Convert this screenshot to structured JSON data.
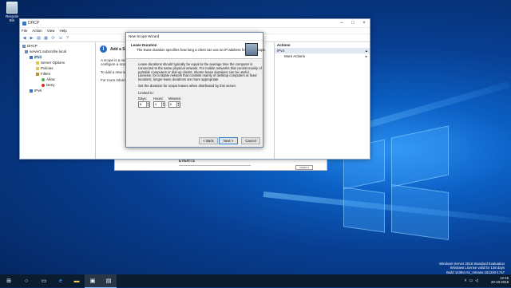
{
  "desktop": {
    "recycle_bin_label": "Recycle Bin",
    "watermark": {
      "line1": "Windows Server 2016 Standard Evaluation",
      "line2": "Windows License valid for 138 days",
      "line3": "Build 14393.rs1_release.161220-1747"
    }
  },
  "background_window": {
    "section_title": "EVENTS",
    "tasks_label": "TASKS ▾"
  },
  "dhcp_window": {
    "title": "DHCP",
    "menu": [
      "File",
      "Action",
      "View",
      "Help"
    ],
    "tree": {
      "root": "DHCP",
      "server": "server1.subscribe.local",
      "ipv4": "IPv4",
      "server_options": "Server Options",
      "policies": "Policies",
      "filters": "Filters",
      "allow": "Allow",
      "deny": "Deny",
      "ipv6": "IPv6"
    },
    "content": {
      "heading": "Add a Sc",
      "line1": "A scope is a range",
      "line2": "configure a scope",
      "line3": "To add a new scop",
      "line4": "For more informati"
    },
    "actions": {
      "header": "Actions",
      "section": "IPv4",
      "more": "More Actions"
    }
  },
  "wizard": {
    "title": "New Scope Wizard",
    "heading": "Lease Duration",
    "subheading": "The lease duration specifies how long a client can use an IP address from this scope.",
    "paragraph": [
      "Lease durations should typically be equal to the average time the computer is",
      "connected to the same physical network. For mobile networks that consist mainly of",
      "portable computers or dial-up clients, shorter lease durations can be useful.",
      "Likewise, for a stable network that consists mainly of desktop computers at fixed",
      "locations, longer lease durations are more appropriate."
    ],
    "instruction": "Set the duration for scope leases when distributed by this server.",
    "limited_to": "Limited to:",
    "days_label": "Days:",
    "hours_label": "Hours:",
    "minutes_label": "Minutes:",
    "days_value": "8",
    "hours_value": "0",
    "minutes_value": "0",
    "back_button": "< Back",
    "next_button": "Next >",
    "cancel_button": "Cancel"
  },
  "taskbar": {
    "time": "12:15",
    "date": "20-10-2018"
  },
  "colors": {
    "taskbar": "#0b1c2e",
    "selection": "#cde6f7",
    "accent": "#2f7fd6"
  }
}
